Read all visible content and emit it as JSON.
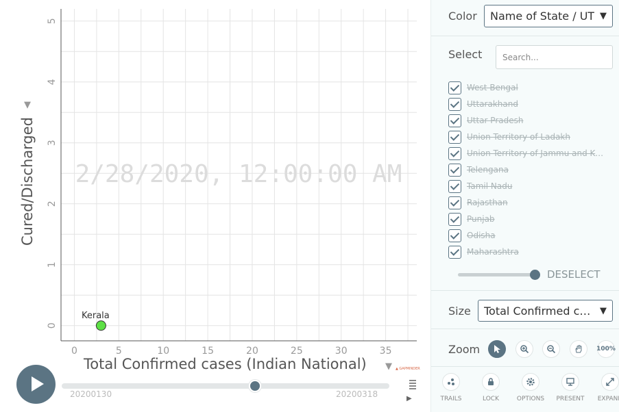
{
  "chart_data": {
    "type": "scatter",
    "xlabel": "Total Confirmed cases (Indian National)",
    "ylabel": "Cured/Discharged",
    "xlim": [
      -1.5,
      38.5
    ],
    "ylim": [
      -0.25,
      5.2
    ],
    "x_ticks": [
      0,
      5,
      10,
      15,
      20,
      25,
      30,
      35
    ],
    "y_ticks": [
      0,
      1,
      2,
      3,
      4,
      5
    ],
    "grid": true,
    "timestamp": "2/28/2020, 12:00:00 AM",
    "points": [
      {
        "label": "Kerala",
        "x": 3,
        "y": 0,
        "color": "#5de045"
      }
    ]
  },
  "chart": {
    "credit": "▲ GAPMINDER"
  },
  "timeslider": {
    "start": "20200130",
    "end": "20200318",
    "position": 0.59
  },
  "panel": {
    "color_label": "Color",
    "color_value": "Name of State / UT",
    "select_label": "Select",
    "search_placeholder": "Search...",
    "states": [
      "West Bengal",
      "Uttarakhand",
      "Uttar Pradesh",
      "Union Territory of Ladakh",
      "Union Territory of Jammu and Kashmir",
      "Telengana",
      "Tamil Nadu",
      "Rajasthan",
      "Punjab",
      "Odisha",
      "Maharashtra"
    ],
    "deselect_label": "DESELECT",
    "size_label": "Size",
    "size_value": "Total Confirmed cases (Indian National)",
    "zoom_label": "Zoom",
    "zoom_100": "100%",
    "tools": [
      {
        "label": "TRAILS",
        "icon": "trails-icon"
      },
      {
        "label": "LOCK",
        "icon": "lock-icon"
      },
      {
        "label": "OPTIONS",
        "icon": "gear-icon"
      },
      {
        "label": "PRESENT",
        "icon": "present-icon"
      },
      {
        "label": "EXPAND",
        "icon": "expand-icon"
      }
    ],
    "accent_color": "#5b7483"
  }
}
